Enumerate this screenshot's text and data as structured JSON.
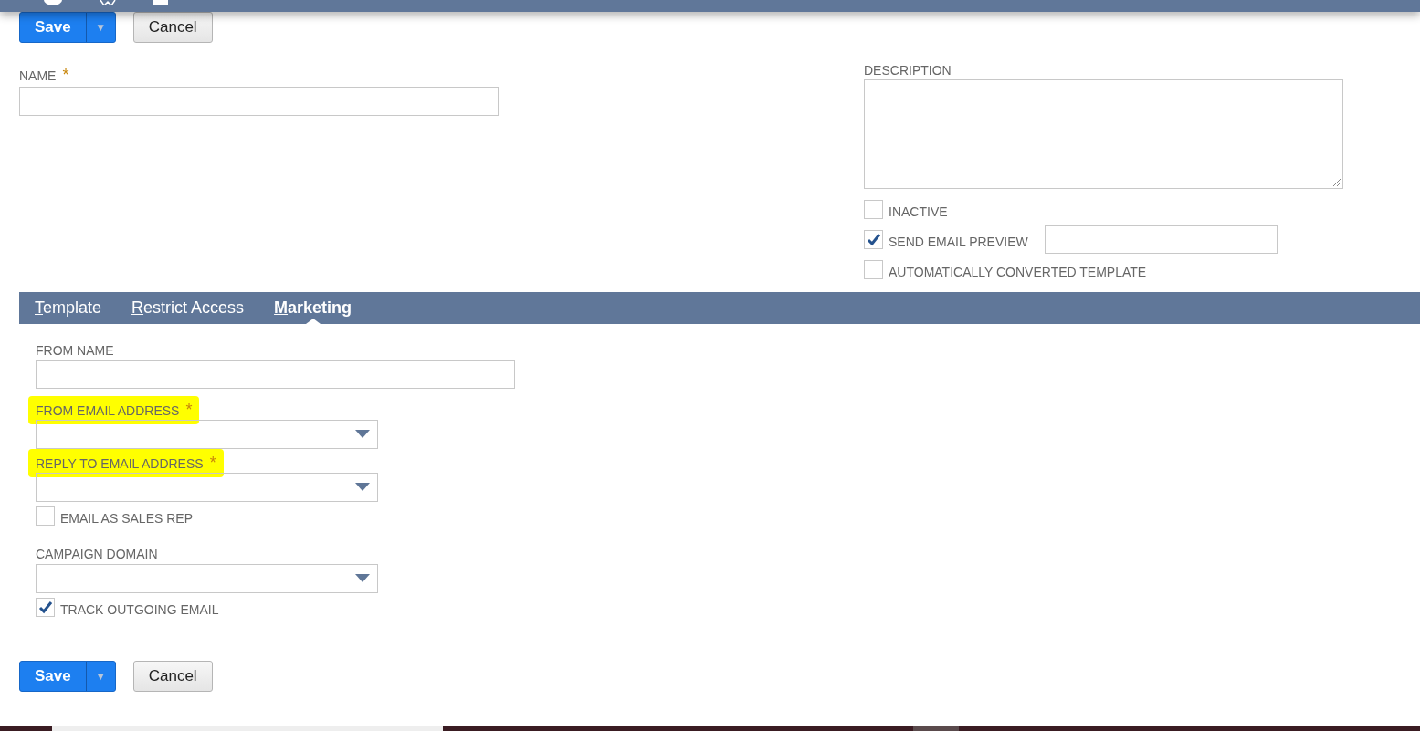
{
  "top_actions": {
    "save": "Save",
    "menu_arrow": "▼",
    "cancel": "Cancel"
  },
  "name_field": {
    "label": "NAME",
    "required_mark": "*",
    "highlighted": false
  },
  "description_field": {
    "label": "DESCRIPTION"
  },
  "options": [
    {
      "label": "INACTIVE",
      "checked": false,
      "kind": "checkbox"
    },
    {
      "label": "SEND EMAIL PREVIEW",
      "checked": true,
      "kind": "checkbox_with_field"
    },
    {
      "label": "AUTOMATICALLY CONVERTED TEMPLATE",
      "checked": false,
      "kind": "checkbox"
    }
  ],
  "tabs": [
    {
      "label": "Template",
      "selected": false
    },
    {
      "label": "Restrict Access",
      "selected": false
    },
    {
      "label": "Marketing",
      "selected": true
    }
  ],
  "marketing_fields": [
    {
      "kind": "text",
      "label": "FROM NAME",
      "highlighted": false
    },
    {
      "kind": "select",
      "label": "FROM EMAIL ADDRESS",
      "required_mark": "*",
      "highlighted": true
    },
    {
      "kind": "select",
      "label": "REPLY TO EMAIL ADDRESS",
      "required_mark": "*",
      "highlighted": true
    },
    {
      "kind": "checkbox",
      "label": "EMAIL AS SALES REP",
      "checked": false
    },
    {
      "kind": "select",
      "label": "CAMPAIGN DOMAIN",
      "highlighted": false
    },
    {
      "kind": "checkbox",
      "label": "TRACK OUTGOING EMAIL",
      "checked": true
    }
  ],
  "bottom_actions": {
    "save": "Save",
    "menu_arrow": "▼",
    "cancel": "Cancel"
  }
}
